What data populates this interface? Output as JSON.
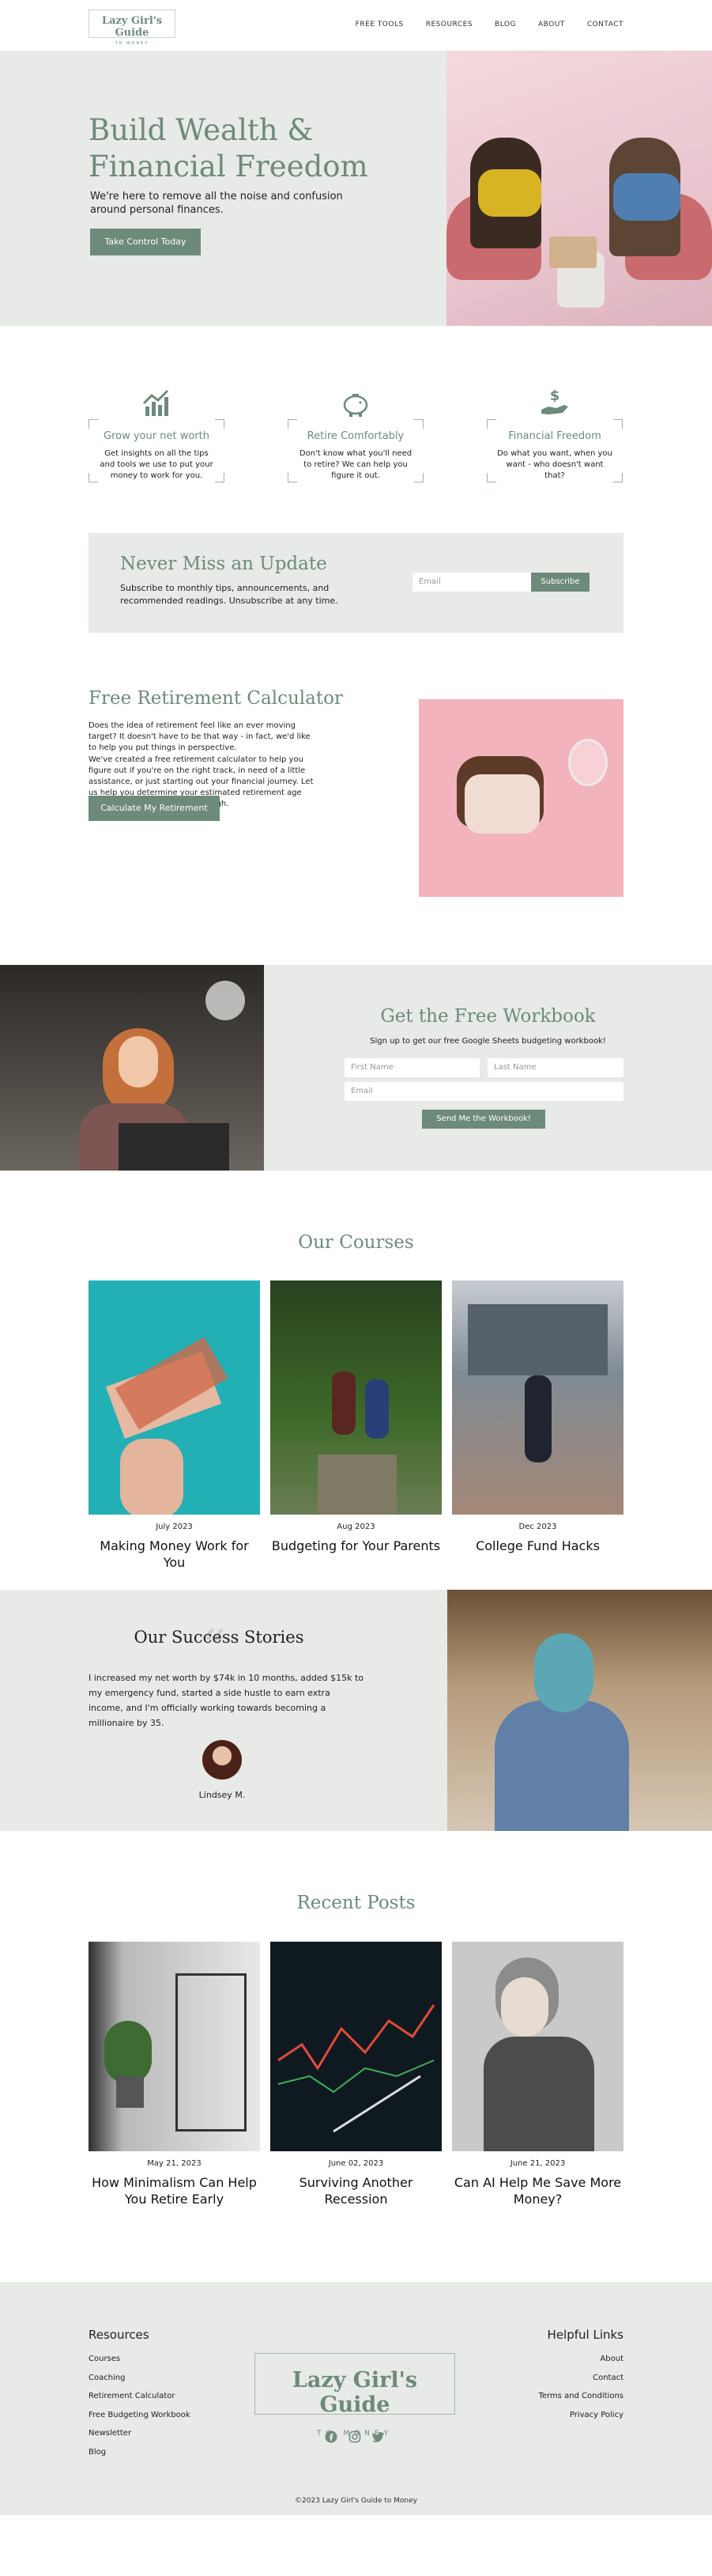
{
  "header": {
    "logo_title": "Lazy Girl's Guide",
    "logo_sub": "TO MONEY",
    "nav": [
      "FREE TOOLS",
      "RESOURCES",
      "BLOG",
      "ABOUT",
      "CONTACT"
    ]
  },
  "hero": {
    "title": "Build Wealth & Financial Freedom",
    "text": "We're here to remove all the noise and confusion around personal finances.",
    "cta": "Take Control Today"
  },
  "features": [
    {
      "icon": "chart-growth-icon",
      "title": "Grow your net worth",
      "text": "Get insights on all the tips and tools we use to put your money to work for you."
    },
    {
      "icon": "piggy-bank-icon",
      "title": "Retire Comfortably",
      "text": "Don't know what you'll need to retire? We can help you figure it out."
    },
    {
      "icon": "hand-dollar-icon",
      "title": "Financial Freedom",
      "text": "Do what you want, when you want - who doesn't want that?"
    }
  ],
  "newsletter": {
    "title": "Never Miss an Update",
    "text": "Subscribe to monthly tips, announcements, and recommended readings. Unsubscribe at any time.",
    "email_placeholder": "Email",
    "button": "Subscribe"
  },
  "calculator": {
    "title": "Free Retirement Calculator",
    "para1": "Does the idea of retirement feel like an ever moving target? It doesn't have to be that way - in fact, we'd like to help you put things in perspective.",
    "para2": "We've created a free retirement calculator to help you figure out if you're on the right track, in need of a little assistance, or just starting out your financial journey. Let us help you determine your estimated retirement age and whether you're saving enough.",
    "button": "Calculate My Retirement"
  },
  "workbook": {
    "title": "Get the Free Workbook",
    "subtitle": "Sign up to get our free Google Sheets budgeting workbook!",
    "first_name": "First Name",
    "last_name": "Last Name",
    "email": "Email",
    "button": "Send Me the Workbook!"
  },
  "courses": {
    "title": "Our Courses",
    "items": [
      {
        "date": "July 2023",
        "title": "Making Money Work for You"
      },
      {
        "date": "Aug 2023",
        "title": "Budgeting for Your Parents"
      },
      {
        "date": "Dec 2023",
        "title": "College Fund Hacks"
      }
    ]
  },
  "stories": {
    "title": "Our Success Stories",
    "quote": "I increased my net worth by $74k in 10 months, added $15k to my emergency fund, started a side hustle to earn extra income, and I'm officially working towards becoming a millionaire by 35.",
    "author": "Lindsey M."
  },
  "posts": {
    "title": "Recent Posts",
    "items": [
      {
        "date": "May 21, 2023",
        "title": "How Minimalism Can Help You Retire Early"
      },
      {
        "date": "June 02, 2023",
        "title": "Surviving Another Recession"
      },
      {
        "date": "June 21, 2023",
        "title": "Can AI Help Me Save More Money?"
      }
    ]
  },
  "footer": {
    "resources_title": "Resources",
    "resources": [
      "Courses",
      "Coaching",
      "Retirement Calculator",
      "Free Budgeting Workbook",
      "Newsletter",
      "Blog"
    ],
    "helpful_title": "Helpful Links",
    "helpful": [
      "About",
      "Contact",
      "Terms and Conditions",
      "Privacy Policy"
    ],
    "logo_title": "Lazy Girl's Guide",
    "logo_sub": "TO MONEY",
    "socials": [
      "facebook-icon",
      "instagram-icon",
      "twitter-icon"
    ],
    "copyright": "©2023 Lazy Girl's Guide to Money"
  },
  "colors": {
    "accent": "#6e8a7a",
    "panel": "#e7eae6"
  }
}
